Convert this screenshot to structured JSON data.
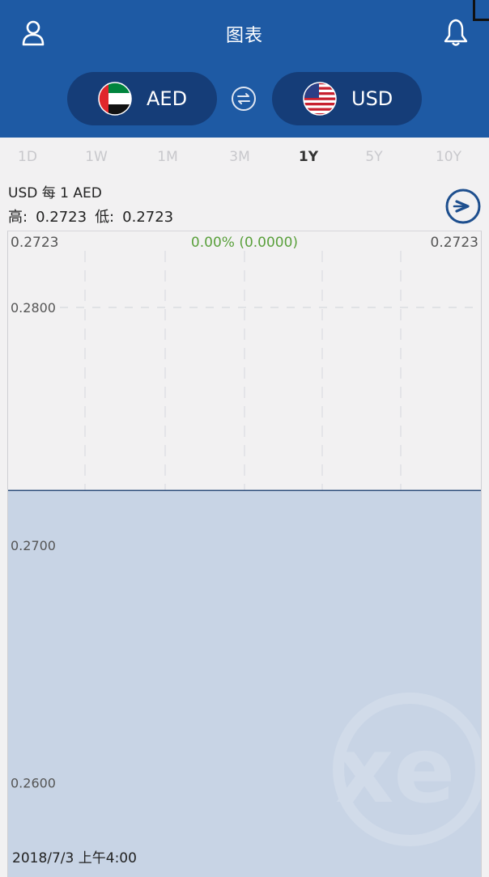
{
  "header": {
    "title": "图表",
    "background": "#1e5aa4",
    "user_icon": "user-icon",
    "bell_icon": "bell-icon"
  },
  "currencies": {
    "from": {
      "code": "AED",
      "flag": "uae-flag-icon"
    },
    "to": {
      "code": "USD",
      "flag": "us-flag-icon"
    },
    "swap_icon": "swap-icon"
  },
  "ranges": {
    "items": [
      "1D",
      "1W",
      "1M",
      "3M",
      "1Y",
      "5Y",
      "10Y"
    ],
    "active": "1Y"
  },
  "rate_info": {
    "caption": "USD 每 1 AED",
    "high_label": "高:",
    "high_value": "0.2723",
    "low_label": "低:",
    "low_value": "0.2723",
    "next_icon": "chevron-right-circle-icon"
  },
  "chart": {
    "start_value": "0.2723",
    "change": "0.00% (0.0000)",
    "end_value": "0.2723",
    "date": "2018/7/3 上午4:00",
    "watermark": "xe",
    "change_color": "#5aa03c",
    "fill_color": "#c8d4e5"
  },
  "chart_data": {
    "type": "area",
    "title": "",
    "xlabel": "",
    "ylabel": "",
    "y_ticks": [
      0.28,
      0.27,
      0.26
    ],
    "y_tick_labels": [
      "0.2800",
      "0.2700",
      "0.2600"
    ],
    "ylim": [
      0.256,
      0.2832
    ],
    "series": [
      {
        "values": [
          0.2723,
          0.2723,
          0.2723,
          0.2723,
          0.2723,
          0.2723,
          0.2723
        ]
      }
    ],
    "grid": true
  }
}
